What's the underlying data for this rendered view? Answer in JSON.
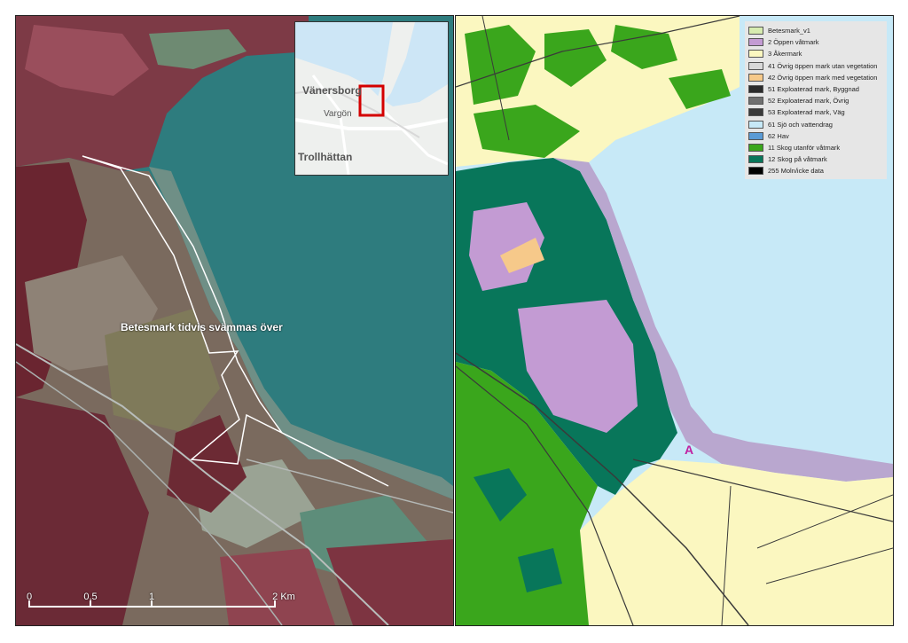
{
  "left_map": {
    "annotation": "Betesmark tidvis svämmas över",
    "inset": {
      "labels": [
        "Vänersborg",
        "Vargön",
        "Trollhättan"
      ]
    },
    "scale": {
      "ticks": [
        "0",
        "0,5",
        "1",
        "2 Km"
      ]
    }
  },
  "right_map": {
    "point_label": "A",
    "legend": {
      "items": [
        {
          "label": "Betesmark_v1",
          "color": "#d7ecb0"
        },
        {
          "label": "2 Öppen våtmark",
          "color": "#c39bd3"
        },
        {
          "label": "3 Åkermark",
          "color": "#fbf7c0"
        },
        {
          "label": "41 Övrig öppen mark utan vegetation",
          "color": "#d9d9d9"
        },
        {
          "label": "42 Övrig öppen mark med vegetation",
          "color": "#f6c98a"
        },
        {
          "label": "51 Exploaterad mark, Byggnad",
          "color": "#2b2b2b"
        },
        {
          "label": "52 Exploaterad mark, Övrig",
          "color": "#707070"
        },
        {
          "label": "53 Exploaterad mark, Väg",
          "color": "#3a3a3a"
        },
        {
          "label": "61 Sjö och vattendrag",
          "color": "#c7e9f7"
        },
        {
          "label": "62 Hav",
          "color": "#5b9bd5"
        },
        {
          "label": "11 Skog utanför våtmark",
          "color": "#3aa61c"
        },
        {
          "label": "12 Skog på våtmark",
          "color": "#08765a"
        },
        {
          "label": "255 Moln/icke data",
          "color": "#000000"
        }
      ]
    }
  }
}
